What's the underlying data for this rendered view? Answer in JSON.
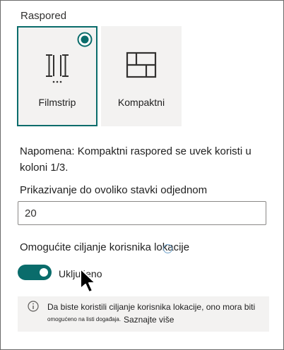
{
  "layout": {
    "label": "Raspored",
    "options": [
      {
        "label": "Filmstrip",
        "icon": "filmstrip-icon",
        "selected": true
      },
      {
        "label": "Kompaktni",
        "icon": "compact-grid-icon",
        "selected": false
      }
    ]
  },
  "note": "Napomena: Kompaktni raspored se uvek koristi u koloni 1/3.",
  "items_count": {
    "label": "Prikazivanje do ovoliko stavki odjednom",
    "value": "20"
  },
  "targeting": {
    "label": "Omogućite ciljanje korisnika lokacije",
    "toggle_on": true,
    "toggle_label": "Uključeno"
  },
  "info": {
    "icon": "info-icon",
    "line1": "Da biste koristili ciljanje korisnika lokacije, ono mora biti",
    "line2": "omogućeno na listi događaja.",
    "learn_more": "Saznajte više"
  },
  "colors": {
    "accent": "#0a6c6b",
    "card_bg": "#f3f2f1",
    "info_bg": "#f3f2f1"
  }
}
